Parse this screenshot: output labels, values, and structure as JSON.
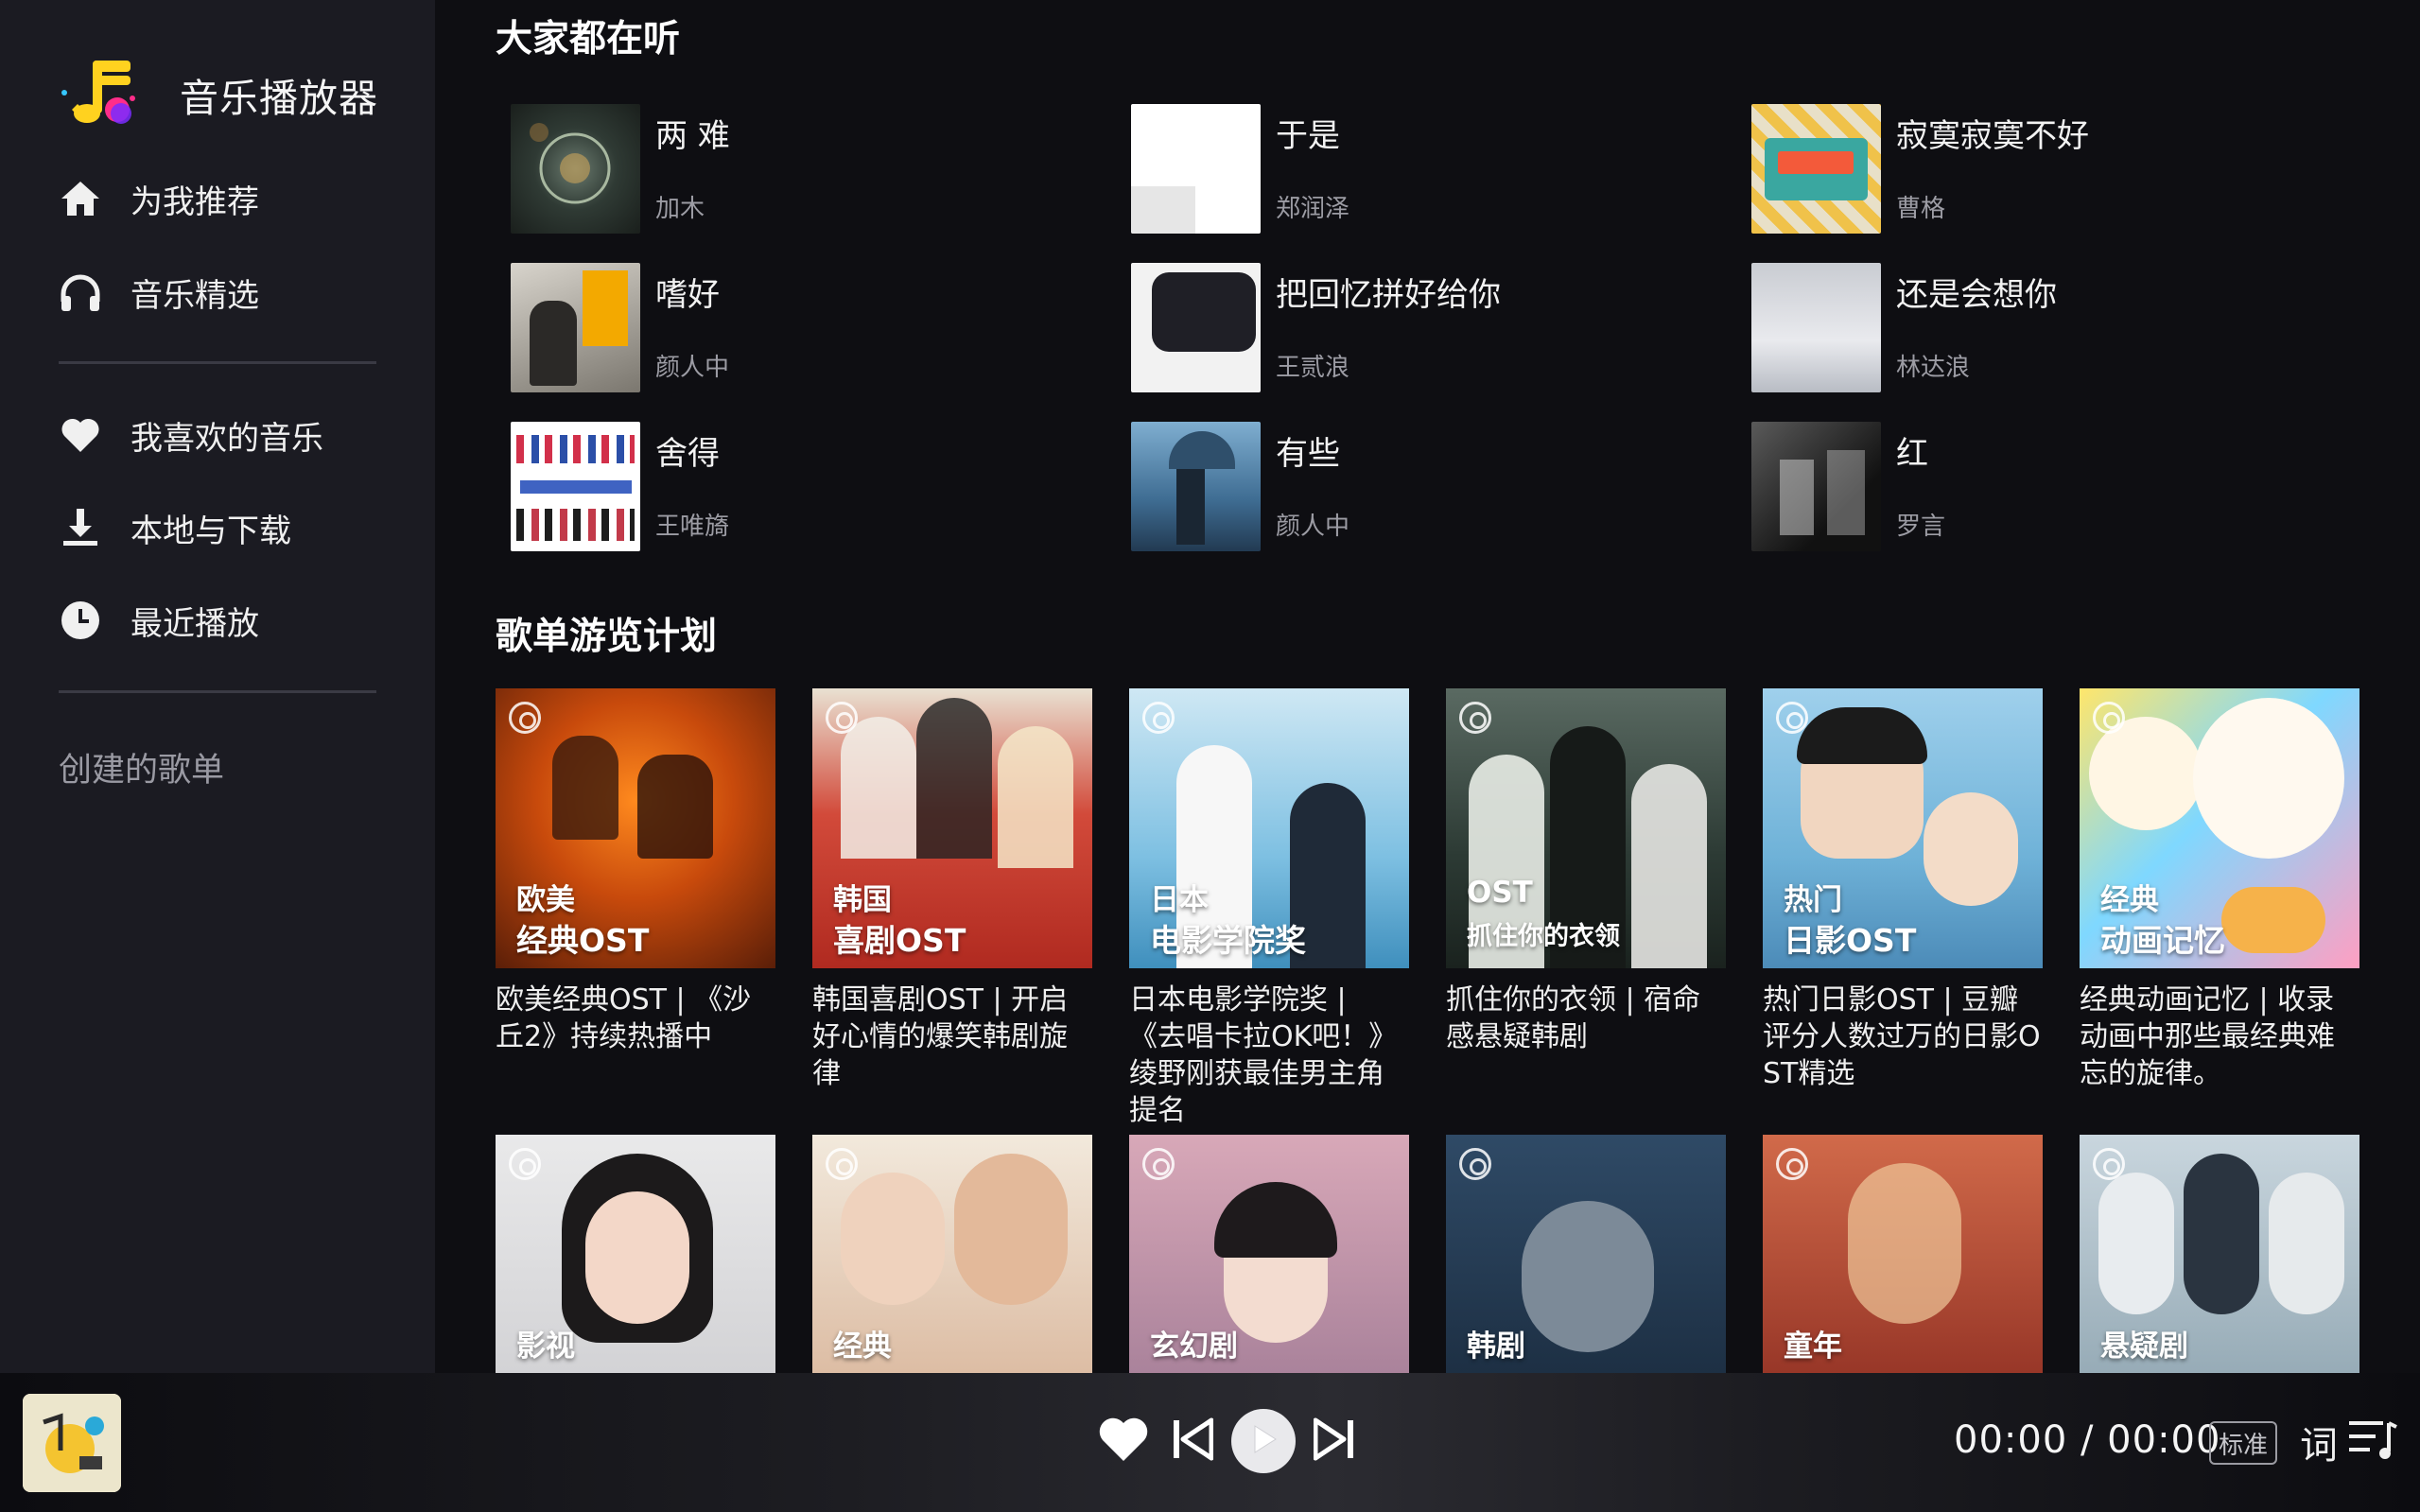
{
  "app": {
    "title": "音乐播放器"
  },
  "sidebar": {
    "nav": [
      {
        "label": "为我推荐",
        "icon": "home-icon"
      },
      {
        "label": "音乐精选",
        "icon": "headphones-icon"
      }
    ],
    "library": [
      {
        "label": "我喜欢的音乐",
        "icon": "heart-icon"
      },
      {
        "label": "本地与下载",
        "icon": "download-icon"
      },
      {
        "label": "最近播放",
        "icon": "clock-icon"
      }
    ],
    "created_playlists_label": "创建的歌单"
  },
  "main": {
    "popular_title": "大家都在听",
    "songs": [
      {
        "title": "两 难",
        "artist": "加木"
      },
      {
        "title": "于是",
        "artist": "郑润泽"
      },
      {
        "title": "寂寞寂寞不好",
        "artist": "曹格"
      },
      {
        "title": "嗜好",
        "artist": "颜人中"
      },
      {
        "title": "把回忆拼好给你",
        "artist": "王贰浪"
      },
      {
        "title": "还是会想你",
        "artist": "林达浪"
      },
      {
        "title": "舍得",
        "artist": "王唯旖"
      },
      {
        "title": "有些",
        "artist": "颜人中"
      },
      {
        "title": "红",
        "artist": "罗言"
      }
    ],
    "playlist_title": "歌单游览计划",
    "playlists": [
      {
        "cap1": "欧美",
        "cap2": "经典OST",
        "desc": "欧美经典OST | 《沙丘2》持续热播中"
      },
      {
        "cap1": "韩国",
        "cap2": "喜剧OST",
        "desc": "韩国喜剧OST | 开启好心情的爆笑韩剧旋律"
      },
      {
        "cap1": "日本",
        "cap2": "电影学院奖",
        "desc": "日本电影学院奖 | 《去唱卡拉OK吧！》绫野刚获最佳男主角提名"
      },
      {
        "cap1": "OST",
        "cap2": "抓住你的衣领",
        "desc": "抓住你的衣领 | 宿命感悬疑韩剧"
      },
      {
        "cap1": "热门",
        "cap2": "日影OST",
        "desc": "热门日影OST | 豆瓣评分人数过万的日影OST精选"
      },
      {
        "cap1": "经典",
        "cap2": "动画记忆",
        "desc": "经典动画记忆 | 收录动画中那些最经典难忘的旋律。"
      },
      {
        "cap1": "影视",
        "cap2": "",
        "desc": ""
      },
      {
        "cap1": "经典",
        "cap2": "",
        "desc": ""
      },
      {
        "cap1": "玄幻剧",
        "cap2": "",
        "desc": ""
      },
      {
        "cap1": "韩剧",
        "cap2": "",
        "desc": ""
      },
      {
        "cap1": "童年",
        "cap2": "",
        "desc": ""
      },
      {
        "cap1": "悬疑剧",
        "cap2": "",
        "desc": ""
      }
    ]
  },
  "player": {
    "time": "00:00 / 00:00",
    "quality": "标准",
    "lyrics_label": "词"
  },
  "colors": {
    "sidebar_bg": "#1b1b22",
    "main_bg": "#0e0e12",
    "accent_yellow": "#ffd21f",
    "accent_pink": "#ff2d8a",
    "accent_purple": "#7a2cff"
  }
}
